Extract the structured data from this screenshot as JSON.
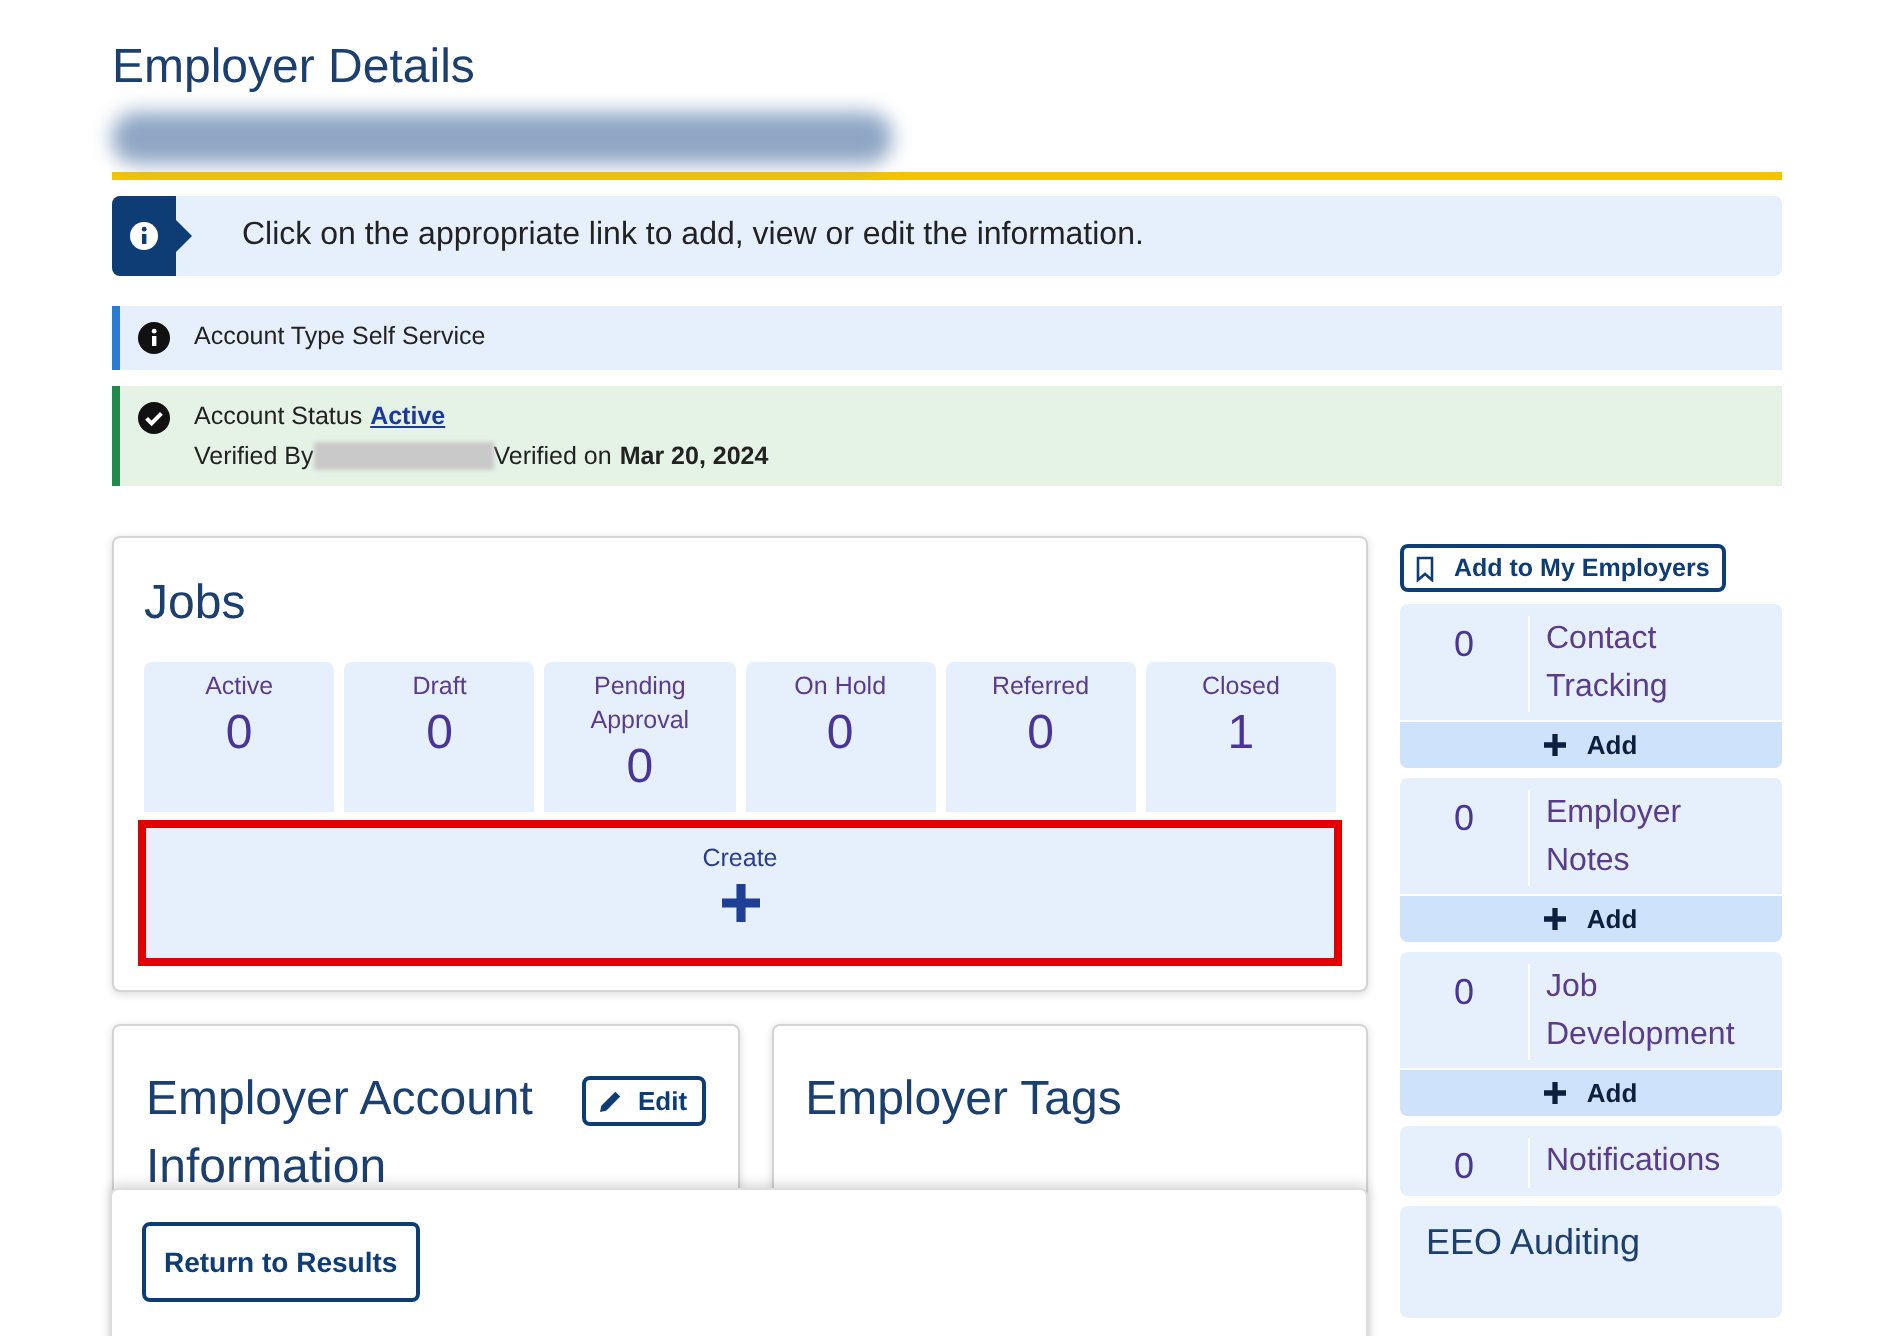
{
  "page": {
    "title": "Employer Details"
  },
  "info_banner": {
    "text": "Click on the appropriate link to add, view or edit the information."
  },
  "account_type": {
    "text": "Account Type Self Service"
  },
  "account_status": {
    "label": "Account Status",
    "status": "Active",
    "verified_by_label": "Verified By",
    "verified_on_label": "Verified on",
    "verified_date": "Mar 20, 2024"
  },
  "jobs": {
    "title": "Jobs",
    "stats": [
      {
        "label": "Active",
        "count": "0"
      },
      {
        "label": "Draft",
        "count": "0"
      },
      {
        "label": "Pending Approval",
        "count": "0"
      },
      {
        "label": "On Hold",
        "count": "0"
      },
      {
        "label": "Referred",
        "count": "0"
      },
      {
        "label": "Closed",
        "count": "1"
      }
    ],
    "create": {
      "label": "Create",
      "highlighted": true
    }
  },
  "account_info": {
    "title": "Employer Account Information",
    "edit_button": "Edit"
  },
  "tags": {
    "title": "Employer Tags"
  },
  "footer": {
    "button": "Return to Results"
  },
  "sidebar": {
    "add_button": "Add to My Employers",
    "items": [
      {
        "count": "0",
        "label": "Contact Tracking",
        "add": "Add"
      },
      {
        "count": "0",
        "label": "Employer Notes",
        "add": "Add"
      },
      {
        "count": "0",
        "label": "Job Development",
        "add": "Add"
      },
      {
        "count": "0",
        "label": "Notifications"
      }
    ],
    "section": "EEO Auditing"
  }
}
